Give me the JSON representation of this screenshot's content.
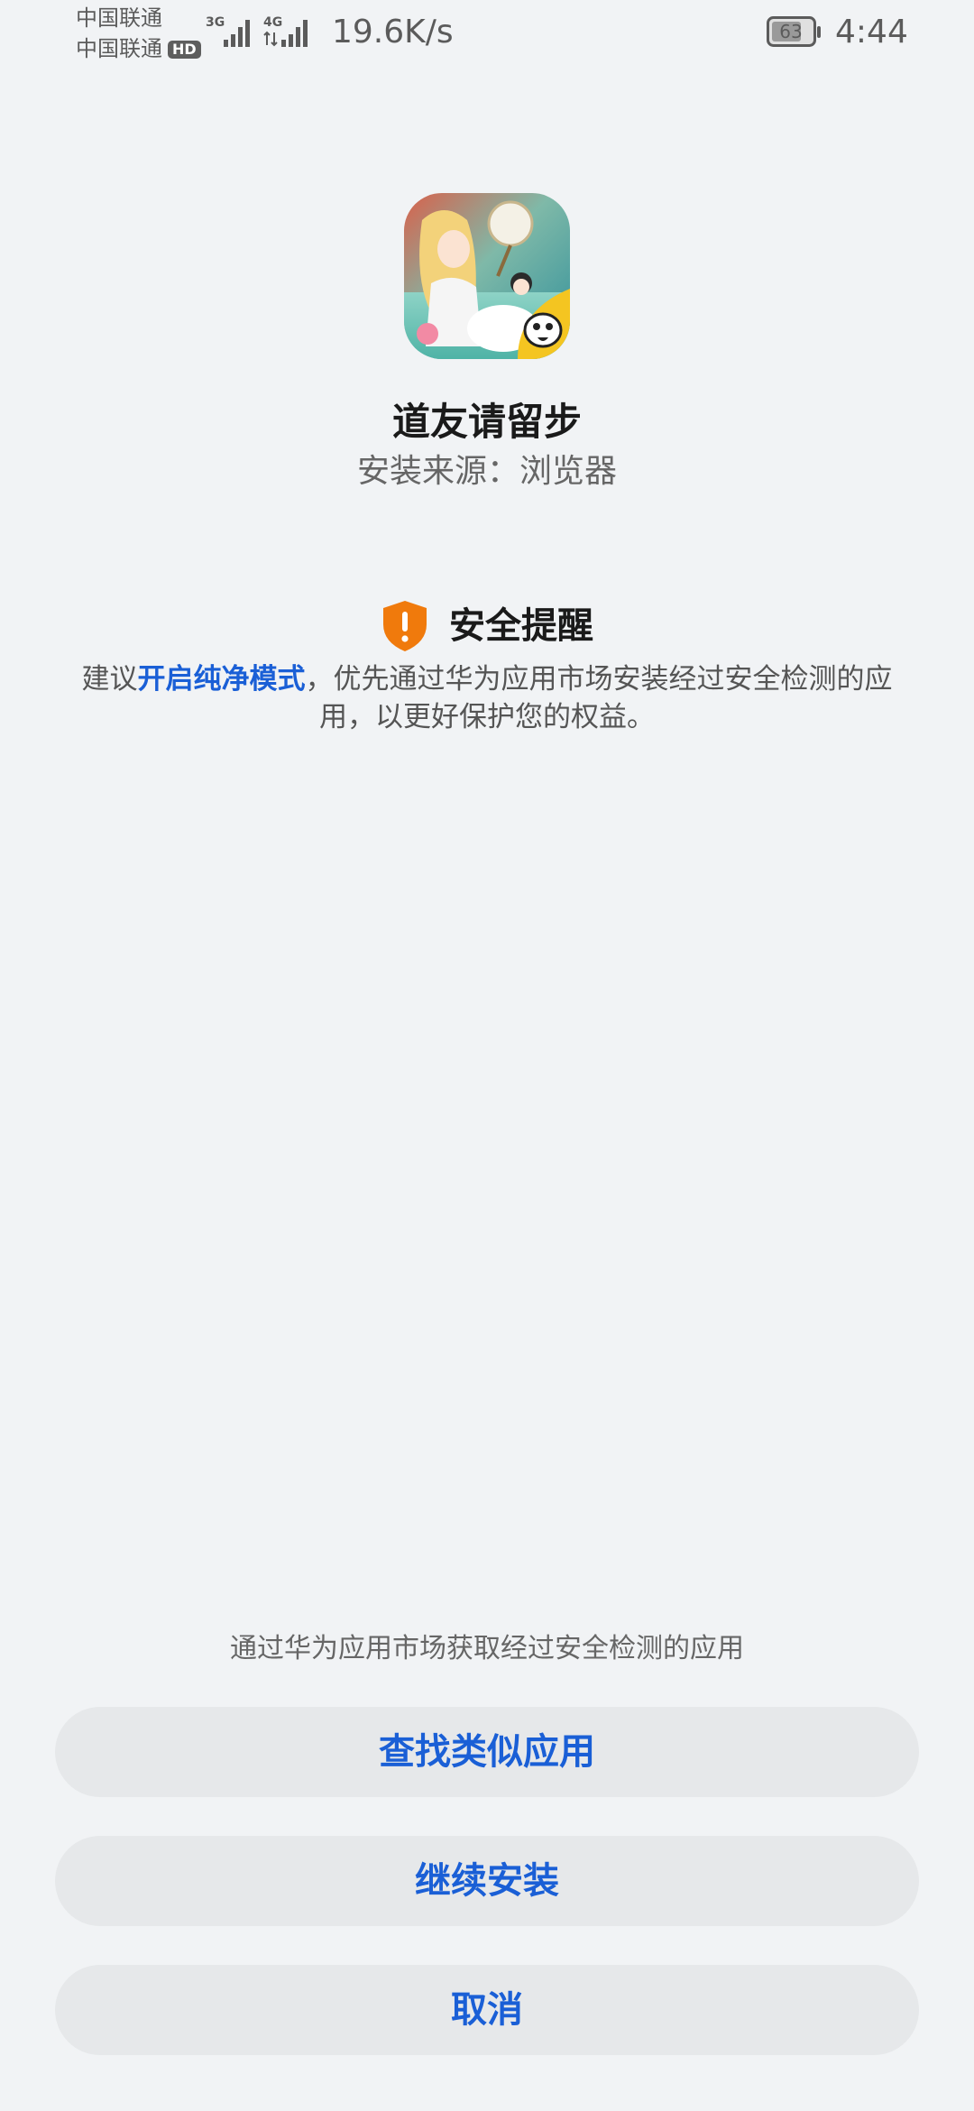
{
  "status_bar": {
    "carrier_1": "中国联通",
    "carrier_2": "中国联通",
    "hd_badge": "HD",
    "signal_1_type": "3G",
    "signal_2_type": "4G",
    "net_speed": "19.6K/s",
    "battery_level": "63",
    "time": "4:44"
  },
  "app": {
    "icon": "app-icon-illustration",
    "name": "道友请留步",
    "install_source": "安装来源：浏览器"
  },
  "security": {
    "icon": "shield-warning-icon",
    "title": "安全提醒",
    "body_prefix": "建议",
    "pure_mode_link": "开启纯净模式",
    "body_suffix": "，优先通过华为应用市场安装经过安全检测的应用，以更好保护您的权益。"
  },
  "bottom": {
    "hint": "通过华为应用市场获取经过安全检测的应用",
    "find_similar_label": "查找类似应用",
    "continue_install_label": "继续安装",
    "cancel_label": "取消"
  },
  "colors": {
    "background": "#f1f3f5",
    "accent_blue": "#1a5fd6",
    "warning_orange": "#f07a0c",
    "button_bg": "#e6e8ea"
  }
}
